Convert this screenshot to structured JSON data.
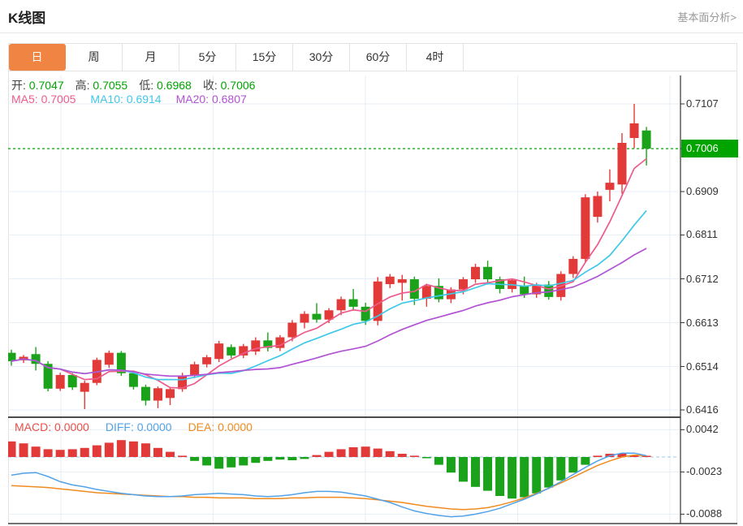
{
  "header": {
    "title": "K线图",
    "link": "基本面分析>"
  },
  "tabs": {
    "items": [
      "日",
      "周",
      "月",
      "5分",
      "15分",
      "30分",
      "60分",
      "4时"
    ],
    "selected_index": 0,
    "selected_color": "#ef8443"
  },
  "readout": {
    "ohlc": [
      {
        "label": "开:",
        "value": "0.7047"
      },
      {
        "label": "高:",
        "value": "0.7055"
      },
      {
        "label": "低:",
        "value": "0.6968"
      },
      {
        "label": "收:",
        "value": "0.7006"
      }
    ],
    "ohlc_value_color": "#00a400",
    "ma": [
      {
        "label": "MA5:",
        "value": "0.7005",
        "color": "#ee5a8c"
      },
      {
        "label": "MA10:",
        "value": "0.6914",
        "color": "#3fc8e8"
      },
      {
        "label": "MA20:",
        "value": "0.6807",
        "color": "#b153d2"
      }
    ]
  },
  "macd_readout": [
    {
      "label": "MACD:",
      "value": "0.0000",
      "color": "#e8504a"
    },
    {
      "label": "DIFF:",
      "value": "0.0000",
      "color": "#52a2e8"
    },
    {
      "label": "DEA:",
      "value": "0.0000",
      "color": "#f08b1f"
    }
  ],
  "colors": {
    "up": "#e23a38",
    "down": "#1aa31a",
    "ma5": "#ee5a8c",
    "ma10": "#3fc8e8",
    "ma20": "#b153d2",
    "diff": "#52a2e8",
    "dea": "#f08b1f",
    "current_price_bg": "#00a400",
    "grid": "#e7eef5",
    "zero_dash": "#aed4ee",
    "axis": "#333333",
    "tab_selected": "#ef8443"
  },
  "chart_data": {
    "type": "candlestick+macd",
    "title": "K线图",
    "legend": [
      "MA5",
      "MA10",
      "MA20",
      "MACD",
      "DIFF",
      "DEA"
    ],
    "price_axis": {
      "tick_labels": [
        "0.7107",
        "0.7006",
        "0.6909",
        "0.6811",
        "0.6712",
        "0.6613",
        "0.6514",
        "0.6416"
      ],
      "ticks": [
        0.7107,
        0.7006,
        0.6909,
        0.6811,
        0.6712,
        0.6613,
        0.6514,
        0.6416
      ],
      "current_price": "0.7006",
      "current_price_value": 0.7006
    },
    "macd_axis": {
      "tick_labels": [
        "0.0042",
        "-0.0023",
        "-0.0088"
      ],
      "ticks": [
        0.0042,
        -0.0023,
        -0.0088
      ]
    },
    "today": {
      "open": 0.7047,
      "high": 0.7055,
      "low": 0.6968,
      "close": 0.7006
    },
    "ma_values": {
      "ma5": 0.7005,
      "ma10": 0.6914,
      "ma20": 0.6807
    },
    "macd_values": {
      "macd": 0.0,
      "diff": 0.0,
      "dea": 0.0
    },
    "candles_ohlc": [
      [
        0.6545,
        0.6552,
        0.6516,
        0.6526
      ],
      [
        0.6528,
        0.654,
        0.6522,
        0.6536
      ],
      [
        0.6542,
        0.6558,
        0.6505,
        0.652
      ],
      [
        0.652,
        0.6526,
        0.6458,
        0.6464
      ],
      [
        0.6464,
        0.65,
        0.6459,
        0.6495
      ],
      [
        0.6495,
        0.6499,
        0.6461,
        0.6467
      ],
      [
        0.6457,
        0.6482,
        0.6418,
        0.6477
      ],
      [
        0.6477,
        0.6534,
        0.6472,
        0.6529
      ],
      [
        0.6518,
        0.655,
        0.6511,
        0.6545
      ],
      [
        0.6545,
        0.6549,
        0.6493,
        0.6499
      ],
      [
        0.6499,
        0.6505,
        0.6462,
        0.6468
      ],
      [
        0.6468,
        0.6473,
        0.6426,
        0.6437
      ],
      [
        0.6437,
        0.6469,
        0.642,
        0.6465
      ],
      [
        0.6443,
        0.6468,
        0.6427,
        0.6463
      ],
      [
        0.6463,
        0.65,
        0.6457,
        0.6494
      ],
      [
        0.6494,
        0.6525,
        0.6488,
        0.6519
      ],
      [
        0.6519,
        0.654,
        0.6512,
        0.6535
      ],
      [
        0.6531,
        0.6572,
        0.6524,
        0.6566
      ],
      [
        0.6558,
        0.6564,
        0.6533,
        0.6539
      ],
      [
        0.6539,
        0.6565,
        0.6533,
        0.656
      ],
      [
        0.6548,
        0.658,
        0.654,
        0.6573
      ],
      [
        0.6573,
        0.6591,
        0.6548,
        0.6556
      ],
      [
        0.6556,
        0.6585,
        0.6549,
        0.658
      ],
      [
        0.658,
        0.6619,
        0.6571,
        0.6613
      ],
      [
        0.6613,
        0.6639,
        0.66,
        0.6633
      ],
      [
        0.6633,
        0.6657,
        0.6613,
        0.662
      ],
      [
        0.662,
        0.6646,
        0.6612,
        0.6641
      ],
      [
        0.6641,
        0.6672,
        0.663,
        0.6666
      ],
      [
        0.6666,
        0.6689,
        0.664,
        0.6649
      ],
      [
        0.6649,
        0.6658,
        0.6608,
        0.6617
      ],
      [
        0.6617,
        0.6716,
        0.6607,
        0.6706
      ],
      [
        0.67,
        0.6723,
        0.6691,
        0.6717
      ],
      [
        0.6703,
        0.6721,
        0.6663,
        0.6711
      ],
      [
        0.6711,
        0.6717,
        0.6653,
        0.6667
      ],
      [
        0.6667,
        0.6701,
        0.6649,
        0.6696
      ],
      [
        0.6696,
        0.6713,
        0.6659,
        0.6666
      ],
      [
        0.6666,
        0.6693,
        0.6657,
        0.6688
      ],
      [
        0.6688,
        0.6716,
        0.6677,
        0.6711
      ],
      [
        0.6711,
        0.6746,
        0.6703,
        0.6739
      ],
      [
        0.6739,
        0.6753,
        0.6699,
        0.6711
      ],
      [
        0.6711,
        0.6717,
        0.6679,
        0.6689
      ],
      [
        0.6689,
        0.6713,
        0.6681,
        0.6709
      ],
      [
        0.6696,
        0.6717,
        0.6669,
        0.6677
      ],
      [
        0.6677,
        0.6703,
        0.6669,
        0.6699
      ],
      [
        0.6699,
        0.6707,
        0.6665,
        0.6671
      ],
      [
        0.6671,
        0.6729,
        0.6663,
        0.6723
      ],
      [
        0.6723,
        0.6763,
        0.6714,
        0.6757
      ],
      [
        0.6757,
        0.6903,
        0.6749,
        0.6896
      ],
      [
        0.6852,
        0.6909,
        0.6839,
        0.6899
      ],
      [
        0.6913,
        0.6959,
        0.6887,
        0.6929
      ],
      [
        0.6925,
        0.7041,
        0.6904,
        0.7019
      ],
      [
        0.703,
        0.7107,
        0.7007,
        0.7063
      ],
      [
        0.7047,
        0.7055,
        0.6968,
        0.7006
      ]
    ],
    "macd_hist": [
      0.0024,
      0.0021,
      0.0016,
      0.0012,
      0.0011,
      0.0012,
      0.0014,
      0.0018,
      0.0022,
      0.0026,
      0.0024,
      0.0021,
      0.0014,
      0.0008,
      0.0002,
      -0.0006,
      -0.0013,
      -0.0018,
      -0.0016,
      -0.0013,
      -0.0009,
      -0.0006,
      -0.0004,
      -0.0005,
      -0.0003,
      0.0003,
      0.0008,
      0.0012,
      0.0015,
      0.0016,
      0.0013,
      0.0009,
      0.0005,
      0.0002,
      -0.0001,
      -0.0012,
      -0.0024,
      -0.0038,
      -0.0046,
      -0.0052,
      -0.006,
      -0.0064,
      -0.0062,
      -0.0056,
      -0.0047,
      -0.0036,
      -0.0024,
      -0.0012,
      0.0002,
      0.0005,
      0.0005,
      0.0003,
      0.0001
    ],
    "diff_line": [
      -0.0028,
      -0.0025,
      -0.0024,
      -0.003,
      -0.0038,
      -0.0043,
      -0.0046,
      -0.005,
      -0.0053,
      -0.0056,
      -0.0058,
      -0.006,
      -0.0061,
      -0.0061,
      -0.006,
      -0.0058,
      -0.0057,
      -0.0056,
      -0.0057,
      -0.0058,
      -0.006,
      -0.0061,
      -0.006,
      -0.0058,
      -0.0055,
      -0.0053,
      -0.0053,
      -0.0054,
      -0.0057,
      -0.006,
      -0.0065,
      -0.007,
      -0.0077,
      -0.0083,
      -0.0087,
      -0.009,
      -0.0092,
      -0.0091,
      -0.0088,
      -0.0084,
      -0.0079,
      -0.0072,
      -0.0065,
      -0.0057,
      -0.0048,
      -0.0038,
      -0.0027,
      -0.0016,
      -0.0006,
      0.0002,
      0.0006,
      0.0006,
      0.0002
    ],
    "dea_line": [
      -0.0044,
      -0.0045,
      -0.0046,
      -0.0047,
      -0.0049,
      -0.0051,
      -0.0053,
      -0.0055,
      -0.0056,
      -0.0057,
      -0.0058,
      -0.0059,
      -0.006,
      -0.0061,
      -0.0061,
      -0.0062,
      -0.0062,
      -0.0063,
      -0.0063,
      -0.0063,
      -0.0064,
      -0.0064,
      -0.0064,
      -0.0063,
      -0.0063,
      -0.0062,
      -0.0062,
      -0.0062,
      -0.0063,
      -0.0064,
      -0.0066,
      -0.0068,
      -0.007,
      -0.0073,
      -0.0076,
      -0.0078,
      -0.008,
      -0.0081,
      -0.008,
      -0.0078,
      -0.0074,
      -0.0069,
      -0.0063,
      -0.0056,
      -0.0048,
      -0.004,
      -0.0031,
      -0.0022,
      -0.0013,
      -0.0006,
      0.0,
      0.0003,
      0.0002
    ]
  }
}
